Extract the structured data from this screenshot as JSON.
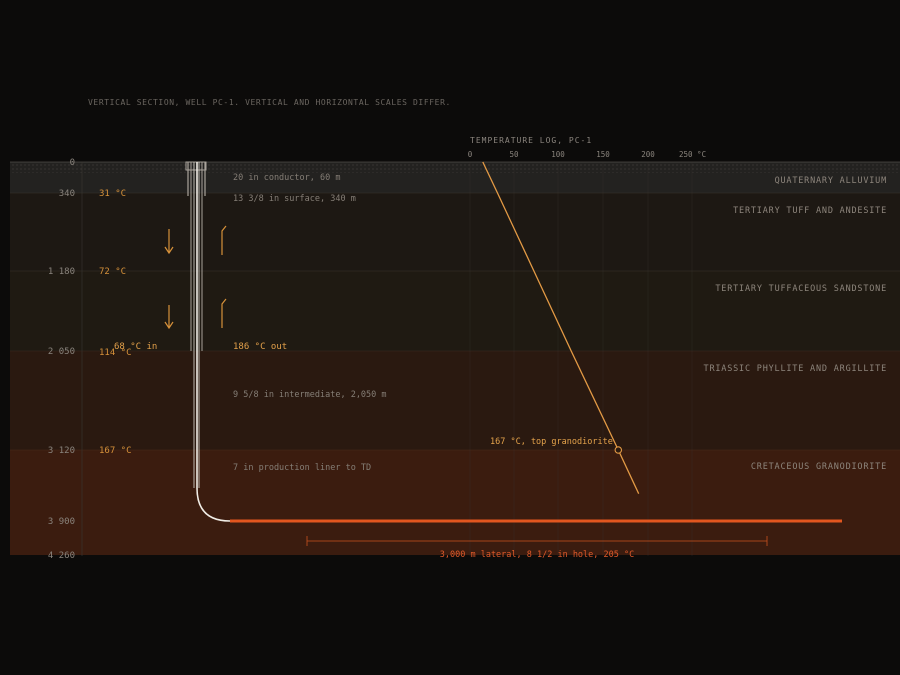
{
  "caption": "VERTICAL SECTION, WELL PC-1. VERTICAL AND HORIZONTAL SCALES DIFFER.",
  "colors": {
    "background": "#0c0b0a",
    "temperature_line": "#e39a45",
    "lateral": "#e2561f",
    "wellbore": "#f1ede6",
    "muted_text": "#8a847d"
  },
  "depth_ticks": [
    "0",
    "340",
    "1 180",
    "2 050",
    "3 120",
    "3 900",
    "4 260"
  ],
  "temperature_labels": [
    "31 °C",
    "72 °C",
    "114 °C",
    "167 °C"
  ],
  "formations": [
    {
      "name": "QUATERNARY ALLUVIUM",
      "fill": "#232220"
    },
    {
      "name": "TERTIARY TUFF AND ANDESITE",
      "fill": "#1d1813"
    },
    {
      "name": "TERTIARY TUFFACEOUS SANDSTONE",
      "fill": "#1f1a12"
    },
    {
      "name": "TRIASSIC PHYLLITE AND ARGILLITE",
      "fill": "#2a1910"
    },
    {
      "name": "CRETACEOUS GRANODIORITE",
      "fill": "#3b1c0f"
    }
  ],
  "casings": [
    "20 in conductor, 60 m",
    "13 3/8 in surface, 340 m",
    "9 5/8 in intermediate, 2,050 m",
    "7 in production liner to TD"
  ],
  "flow": {
    "inlet": "68 °C in",
    "outlet": "186 °C out"
  },
  "temperature_log": {
    "title": "TEMPERATURE LOG, PC-1",
    "ticks": [
      "0",
      "50",
      "100",
      "150",
      "200",
      "250 °C"
    ],
    "callout": "167 °C, top granodiorite"
  },
  "lateral": {
    "label": "3,000 m lateral, 8 1/2 in hole, 205 °C"
  },
  "chart_data": {
    "type": "line",
    "title": "TEMPERATURE LOG, PC-1",
    "series": [
      {
        "x": [
          31,
          72,
          114,
          167,
          190
        ],
        "y": [
          340,
          1180,
          2050,
          3120,
          3600
        ]
      }
    ],
    "xlim": [
      0,
      250
    ],
    "ylim": [
      0,
      4260
    ]
  }
}
